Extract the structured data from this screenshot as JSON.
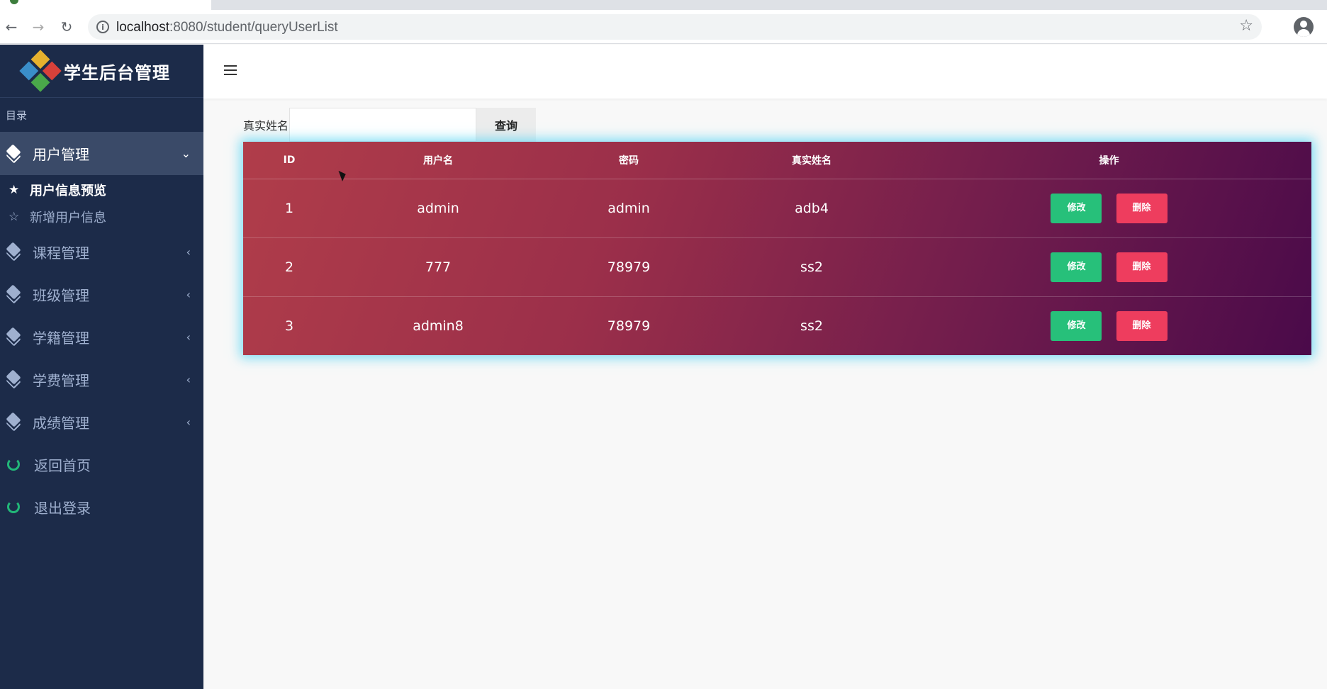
{
  "browser": {
    "url_host": "localhost",
    "url_rest": ":8080/student/queryUserList"
  },
  "sidebar": {
    "brand": "学生后台管理",
    "section_label": "目录",
    "menu": [
      {
        "label": "用户管理",
        "expanded": true,
        "arrow": "⌄"
      },
      {
        "label": "课程管理",
        "arrow": "‹"
      },
      {
        "label": "班级管理",
        "arrow": "‹"
      },
      {
        "label": "学籍管理",
        "arrow": "‹"
      },
      {
        "label": "学费管理",
        "arrow": "‹"
      },
      {
        "label": "成绩管理",
        "arrow": "‹"
      }
    ],
    "sub_items": [
      {
        "label": "用户信息预览",
        "icon": "★"
      },
      {
        "label": "新增用户信息",
        "icon": "☆"
      }
    ],
    "links": [
      {
        "label": "返回首页"
      },
      {
        "label": "退出登录"
      }
    ]
  },
  "search": {
    "label": "真实姓名",
    "value": "",
    "button": "查询"
  },
  "table": {
    "columns": [
      "ID",
      "用户名",
      "密码",
      "真实姓名",
      "操作"
    ],
    "rows": [
      {
        "id": "1",
        "username": "admin",
        "password": "admin",
        "realname": "adb4"
      },
      {
        "id": "2",
        "username": "777",
        "password": "78979",
        "realname": "ss2"
      },
      {
        "id": "3",
        "username": "admin8",
        "password": "78979",
        "realname": "ss2"
      }
    ],
    "edit_label": "修改",
    "delete_label": "删除"
  },
  "colors": {
    "sidebar_bg": "#1c2b49",
    "edit": "#27c07a",
    "delete": "#ee3d5e",
    "glow": "#5ed6f4"
  }
}
